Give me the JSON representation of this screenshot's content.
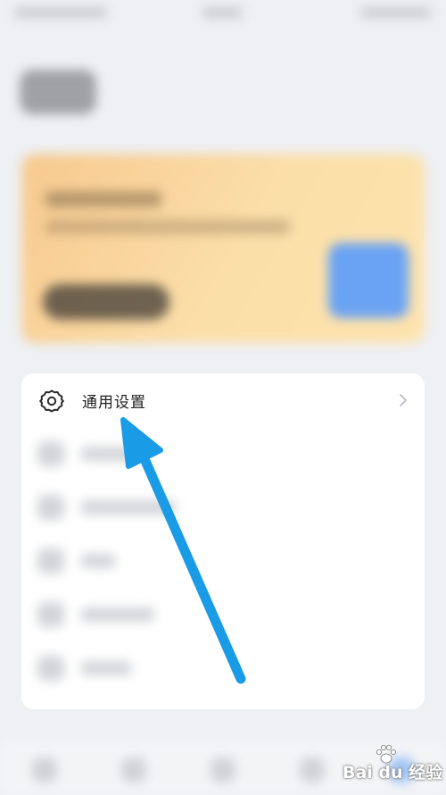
{
  "menu": {
    "items": [
      {
        "label": "通用设置",
        "icon": "gear-icon"
      }
    ]
  },
  "annotation": {
    "arrow_color": "#1a9be6"
  },
  "watermark": {
    "text": "Bai du 经验"
  },
  "colors": {
    "background": "#eef0f4",
    "card": "#ffffff",
    "banner": "#fbd9a4"
  }
}
